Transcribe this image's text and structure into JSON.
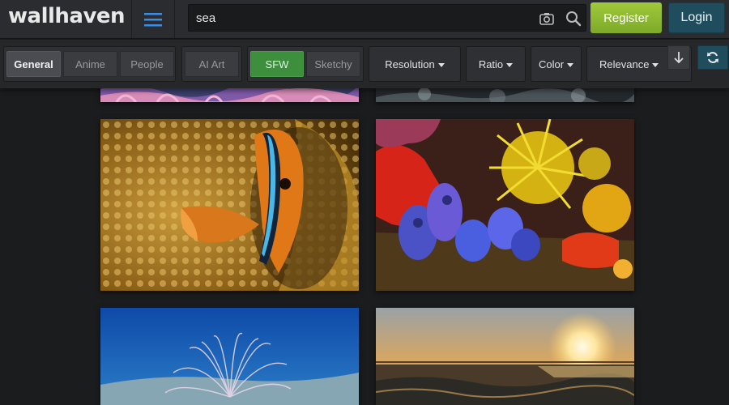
{
  "header": {
    "logo": "wallhaven",
    "search": {
      "value": "sea",
      "placeholder": "Search"
    },
    "register_label": "Register",
    "login_label": "Login",
    "icons": {
      "menu": "menu-icon",
      "camera": "camera-icon",
      "search": "search-icon"
    }
  },
  "filters": {
    "categories": [
      {
        "label": "General",
        "active": true
      },
      {
        "label": "Anime",
        "active": false
      },
      {
        "label": "People",
        "active": false
      }
    ],
    "ai_art": {
      "label": "AI Art",
      "active": false
    },
    "purity": [
      {
        "label": "SFW",
        "active": true
      },
      {
        "label": "Sketchy",
        "active": false
      }
    ],
    "dropdowns": [
      {
        "label": "Resolution"
      },
      {
        "label": "Ratio"
      },
      {
        "label": "Color"
      },
      {
        "label": "Relevance"
      }
    ],
    "sort_direction_icon": "arrow-down-icon",
    "refresh_icon": "refresh-icon"
  },
  "thumbnails": [
    {
      "subject": "sea anemone (partially scrolled)"
    },
    {
      "subject": "dark rocky water (partially scrolled)"
    },
    {
      "subject": "clownfish in anemone"
    },
    {
      "subject": "coral reef with yellow coral and blue tunicates"
    },
    {
      "subject": "tube anemone on sandy seafloor"
    },
    {
      "subject": "sunset over ocean waves"
    }
  ],
  "colors": {
    "accent_green": "#8cba34",
    "login_blue": "#1f4d5e",
    "menu_blue": "#3a8ee6",
    "background": "#1b1c1e"
  }
}
